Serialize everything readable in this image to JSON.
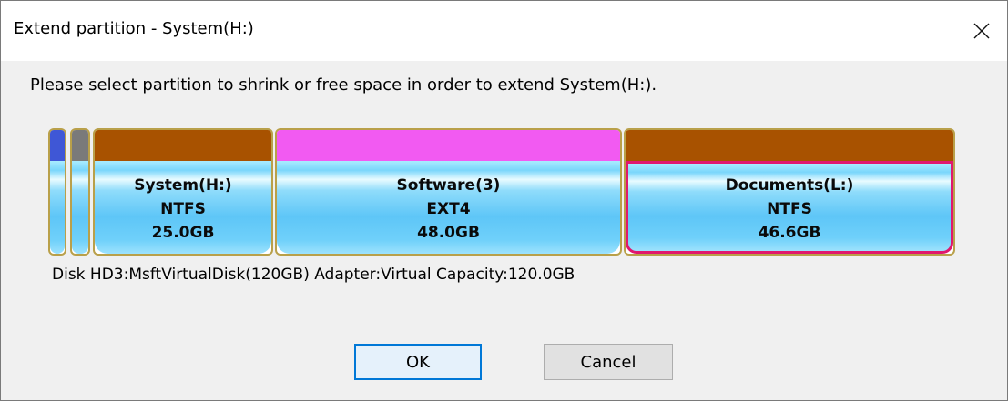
{
  "window": {
    "title": "Extend partition - System(H:)",
    "close_icon": "close-icon"
  },
  "instruction": "Please select partition to shrink or free space in order to extend System(H:).",
  "disk": {
    "info": "Disk HD3:MsftVirtualDisk(120GB)  Adapter:Virtual  Capacity:120.0GB",
    "partitions": [
      {
        "name": "",
        "fs": "",
        "size": "",
        "band_color": "#3f57d6",
        "selected": false
      },
      {
        "name": "",
        "fs": "",
        "size": "",
        "band_color": "#7a7a7a",
        "selected": false
      },
      {
        "name": "System(H:)",
        "fs": "NTFS",
        "size": "25.0GB",
        "band_color": "#a85200",
        "selected": false
      },
      {
        "name": "Software(3)",
        "fs": "EXT4",
        "size": "48.0GB",
        "band_color": "#f25af2",
        "selected": false
      },
      {
        "name": "Documents(L:)",
        "fs": "NTFS",
        "size": "46.6GB",
        "band_color": "#a85200",
        "selected": true
      }
    ]
  },
  "buttons": {
    "ok": "OK",
    "cancel": "Cancel"
  }
}
